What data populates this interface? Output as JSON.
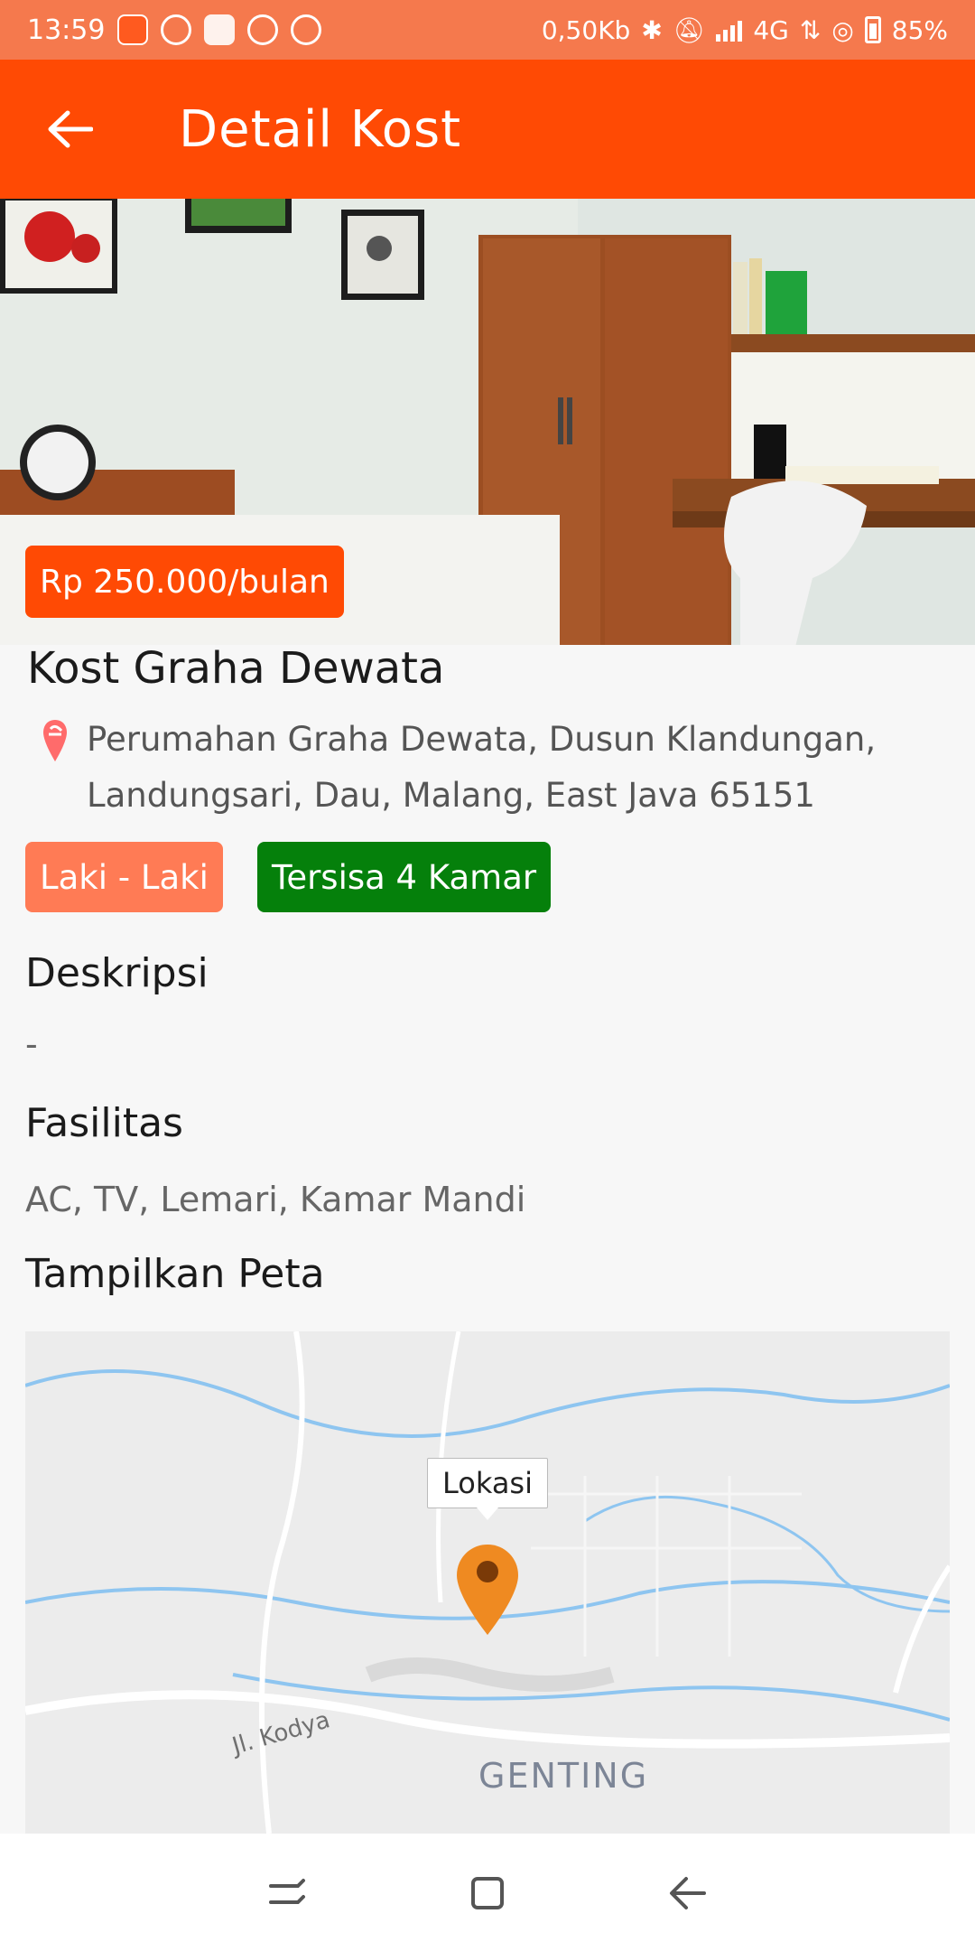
{
  "status_bar": {
    "time": "13:59",
    "speed": "0,50Kb",
    "network": "4G",
    "battery": "85%"
  },
  "app_bar": {
    "title": "Detail Kost",
    "back_icon": "arrow-back-icon"
  },
  "listing": {
    "price": "Rp 250.000/bulan",
    "name": "Kost Graha Dewata",
    "address": "Perumahan Graha Dewata, Dusun Klandungan, Landungsari, Dau, Malang, East Java 65151",
    "gender_badge": "Laki - Laki",
    "rooms_badge": "Tersisa 4 Kamar"
  },
  "description": {
    "heading": "Deskripsi",
    "text": "-"
  },
  "facilities": {
    "heading": "Fasilitas",
    "text": "AC, TV, Lemari, Kamar Mandi"
  },
  "map": {
    "heading": "Tampilkan Peta",
    "marker_label": "Lokasi",
    "road_label": "Jl. Kodya",
    "area_label": "GENTING"
  },
  "colors": {
    "app_bar": "#ff4a04",
    "status_bar": "#f5794d",
    "gender_badge": "#ff7b55",
    "rooms_badge": "#05800b"
  }
}
